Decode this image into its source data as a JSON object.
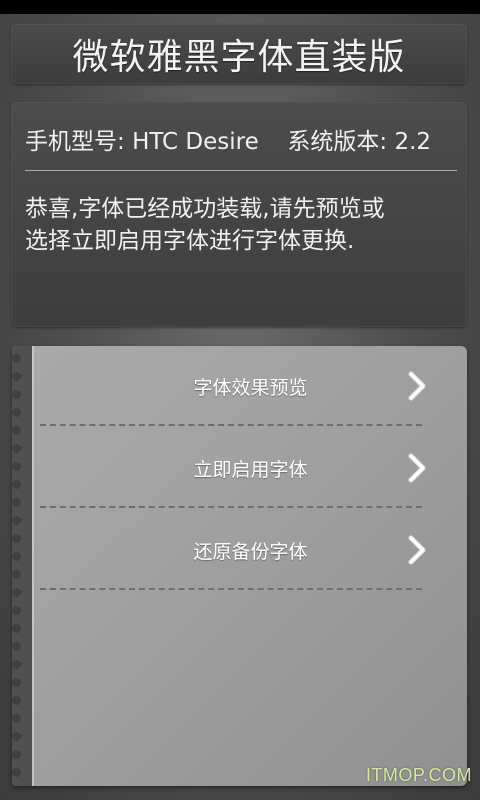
{
  "header": {
    "title": "微软雅黑字体直装版"
  },
  "info": {
    "model_label": "手机型号:",
    "model_value": "HTC Desire",
    "version_label": "系统版本:",
    "version_value": "2.2",
    "message_line1": "恭喜,字体已经成功装载,请先预览或",
    "message_line2": "选择立即启用字体进行字体更换."
  },
  "menu": {
    "items": [
      {
        "label": "字体效果预览",
        "icon": "chevron-right-icon"
      },
      {
        "label": "立即启用字体",
        "icon": "chevron-right-icon"
      },
      {
        "label": "还原备份字体",
        "icon": "chevron-right-icon"
      }
    ]
  },
  "watermark": {
    "text": "ITMOP.COM"
  },
  "colors": {
    "background": "#4b4c4b",
    "panel": "#a9aaa9",
    "watermark": "#d6e8a2"
  }
}
